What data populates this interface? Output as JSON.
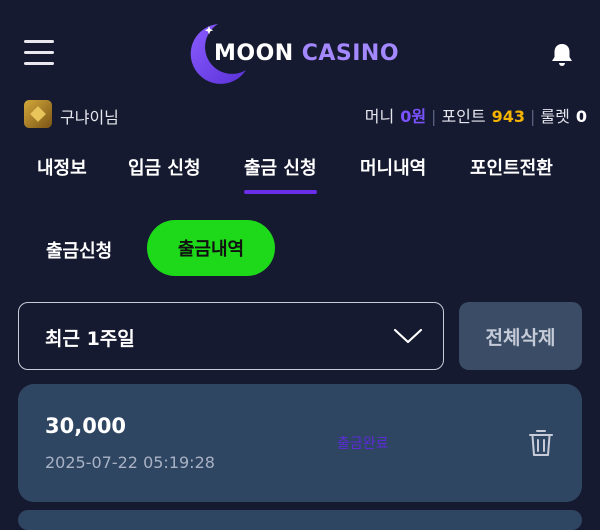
{
  "header": {
    "logo": {
      "word1": "MOON",
      "word2": "CASINO"
    },
    "icons": {
      "menu": "hamburger-menu-icon",
      "notifications": "bell-icon"
    }
  },
  "user": {
    "name": "구냐이님",
    "money_label": "머니",
    "money_value": "0원",
    "point_label": "포인트",
    "point_value": "943",
    "roulette_label": "룰렛",
    "roulette_value": "0"
  },
  "tabs": [
    {
      "label": "내정보",
      "active": false
    },
    {
      "label": "입금 신청",
      "active": false
    },
    {
      "label": "출금 신청",
      "active": true
    },
    {
      "label": "머니내역",
      "active": false
    },
    {
      "label": "포인트전환",
      "active": false
    }
  ],
  "subtabs": [
    {
      "label": "출금신청",
      "active": false
    },
    {
      "label": "출금내역",
      "active": true
    }
  ],
  "filter": {
    "selected": "최근 1주일"
  },
  "delete_all_label": "전체삭제",
  "records": [
    {
      "amount": "30,000",
      "date": "2025-07-22 05:19:28",
      "status": "출금완료"
    }
  ],
  "colors": {
    "background": "#161a30",
    "accent_purple": "#6a2ee8",
    "active_green": "#1ed81a",
    "point_gold": "#f5b300",
    "card": "#2f4663"
  }
}
